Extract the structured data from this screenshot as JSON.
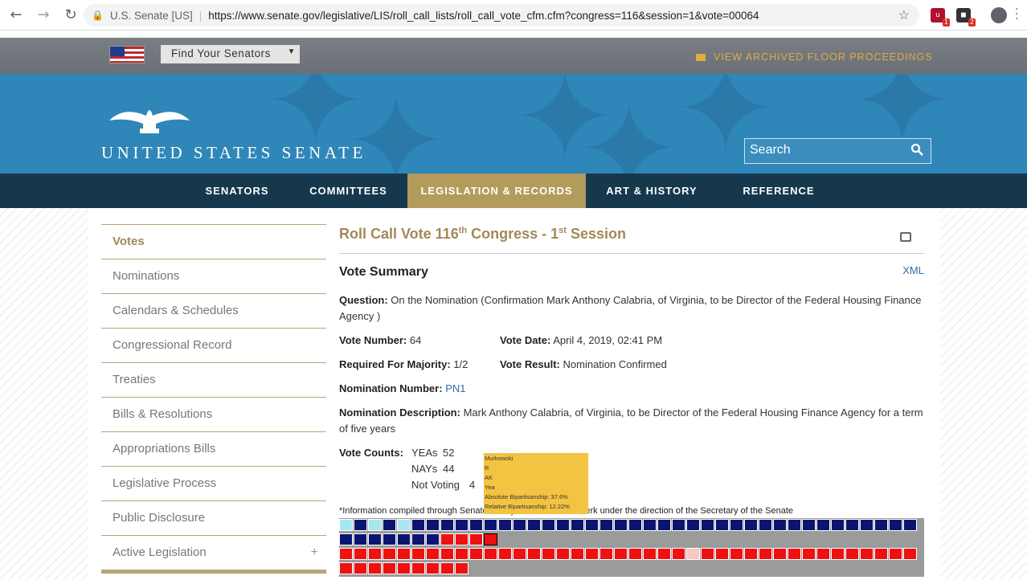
{
  "browser": {
    "site_label": "U.S. Senate [US]",
    "url": "https://www.senate.gov/legislative/LIS/roll_call_lists/roll_call_vote_cfm.cfm?congress=116&session=1&vote=00064",
    "ext1_badge": "1",
    "ext2_badge": "2"
  },
  "utility": {
    "find_senators": "Find Your Senators",
    "archived": "VIEW ARCHIVED FLOOR PROCEEDINGS"
  },
  "header": {
    "logo_text": "UNITED STATES SENATE",
    "search_placeholder": "Search"
  },
  "nav": {
    "items": [
      "SENATORS",
      "COMMITTEES",
      "LEGISLATION & RECORDS",
      "ART & HISTORY",
      "REFERENCE"
    ]
  },
  "sidebar": {
    "items": [
      "Votes",
      "Nominations",
      "Calendars & Schedules",
      "Congressional Record",
      "Treaties",
      "Bills & Resolutions",
      "Appropriations Bills",
      "Legislative Process",
      "Public Disclosure",
      "Active Legislation"
    ]
  },
  "main": {
    "title_prefix": "Roll Call Vote 116",
    "title_sup1": "th",
    "title_mid": " Congress - 1",
    "title_sup2": "st",
    "title_suffix": " Session",
    "subtitle": "Vote Summary",
    "xml": "XML",
    "question_label": "Question:",
    "question_text": "On the Nomination (Confirmation Mark Anthony Calabria, of Virginia, to be Director of the Federal Housing Finance Agency )",
    "vote_number_label": "Vote Number:",
    "vote_number": "64",
    "vote_date_label": "Vote Date:",
    "vote_date": "April 4, 2019, 02:41 PM",
    "majority_label": "Required For Majority:",
    "majority": "1/2",
    "result_label": "Vote Result:",
    "result": "Nomination Confirmed",
    "nomination_number_label": "Nomination Number:",
    "nomination_number": "PN1",
    "nomination_desc_label": "Nomination Description:",
    "nomination_desc": "Mark Anthony Calabria, of Virginia, to be Director of the Federal Housing Finance Agency for a term of five years",
    "vote_counts_label": "Vote Counts:",
    "yeas_label": "YEAs",
    "yeas": "52",
    "nays_label": "NAYs",
    "nays": "44",
    "not_voting_label": "Not Voting",
    "not_voting": "4",
    "footnote": "*Information compiled through Senate LIS by the Senate Bill Clerk under the direction of the Secretary of the Senate"
  },
  "tooltip": {
    "name": "Murkowski",
    "party": "R",
    "state": "AK",
    "vote": "Yea",
    "absolute": "Absolute Bipartisanship: 37.6%",
    "relative": "Relative Bipartisanship: 12.22%"
  },
  "colors": {
    "dem": "#0b1571",
    "dem_light": "#a8e7f0",
    "rep": "#ef1010",
    "rep_light": "#f9c5c5",
    "gray": "#9b9b9b"
  }
}
